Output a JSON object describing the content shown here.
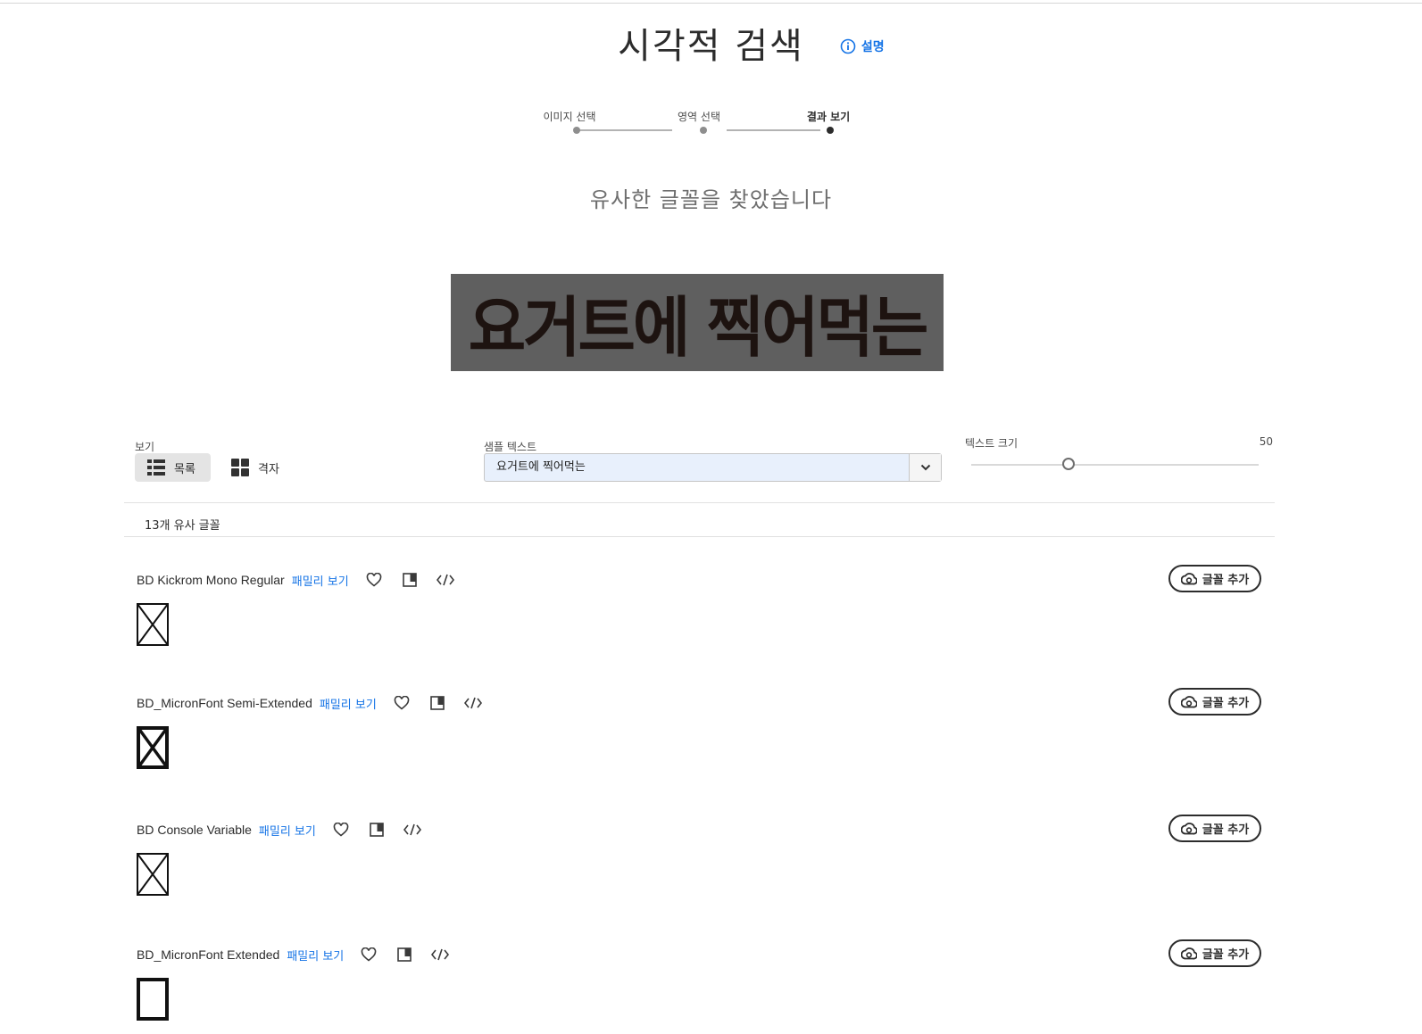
{
  "header": {
    "title": "시각적 검색",
    "help_label": "설명"
  },
  "steps": [
    {
      "label": "이미지 선택",
      "active": false
    },
    {
      "label": "영역 선택",
      "active": false
    },
    {
      "label": "결과 보기",
      "active": true
    }
  ],
  "result_heading": "유사한 글꼴을 찾았습니다",
  "sample_image_text": "요거트에 찍어먹는",
  "controls": {
    "view_label": "보기",
    "view_list_label": "목록",
    "view_grid_label": "격자",
    "view_selected": "목록",
    "sample_text_label": "샘플 텍스트",
    "sample_text_value": "요거트에 찍어먹는",
    "text_size_label": "텍스트 크기",
    "text_size_value": "50",
    "text_size_fraction": 0.34
  },
  "results_count": "13개 유사 글꼴",
  "fonts": [
    {
      "name": "BD Kickrom Mono Regular",
      "family_link": "패밀리 보기",
      "add_label": "글꼴 추가"
    },
    {
      "name": "BD_MicronFont Semi-Extended",
      "family_link": "패밀리 보기",
      "add_label": "글꼴 추가"
    },
    {
      "name": "BD Console Variable",
      "family_link": "패밀리 보기",
      "add_label": "글꼴 추가"
    },
    {
      "name": "BD_MicronFont Extended",
      "family_link": "패밀리 보기",
      "add_label": "글꼴 추가"
    }
  ],
  "colors": {
    "accent": "#1473e6",
    "text": "#2c2c2c",
    "sample_bg": "#5f5f5f",
    "sample_text": "#1d1310"
  },
  "icons": [
    "info-icon",
    "list-view-icon",
    "grid-view-icon",
    "chevron-down-icon",
    "heart-icon",
    "copy-icon",
    "code-icon",
    "creative-cloud-icon"
  ]
}
